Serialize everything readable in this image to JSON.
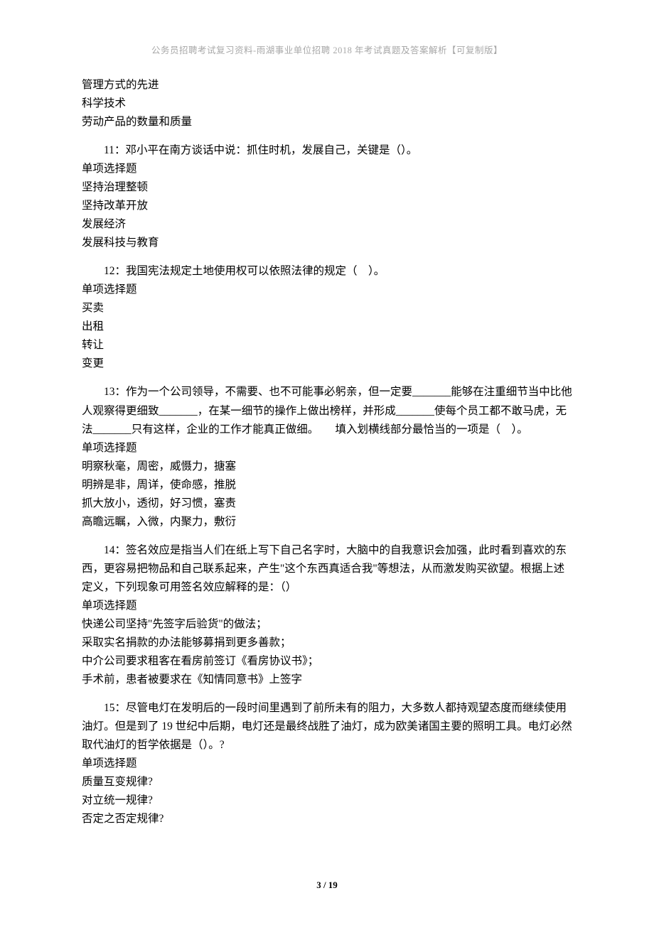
{
  "header": "公务员招聘考试复习资料-雨湖事业单位招聘 2018 年考试真题及答案解析【可复制版】",
  "footer": "3 / 19",
  "leading_options": [
    "管理方式的先进",
    "科学技术",
    "劳动产品的数量和质量"
  ],
  "questions": [
    {
      "number": "11",
      "text": "：邓小平在南方谈话中说：抓住时机，发展自己，关键是（）。",
      "qtype": "单项选择题",
      "options": [
        "坚持治理整顿",
        "坚持改革开放",
        "发展经济",
        "发展科技与教育"
      ]
    },
    {
      "number": "12",
      "text": "：我国宪法规定土地使用权可以依照法律的规定（　）。",
      "qtype": "单项选择题",
      "options": [
        "买卖",
        "出租",
        "转让",
        "变更"
      ]
    },
    {
      "number": "13",
      "text": "：作为一个公司领导，不需要、也不可能事必躬亲，但一定要_______能够在注重细节当中比他人观察得更细致_______，在某一细节的操作上做出榜样，并形成_______使每个员工都不敢马虎，无法_______只有这样，企业的工作才能真正做细。　　填入划横线部分最恰当的一项是（　）。",
      "qtype": "单项选择题",
      "options": [
        "明察秋毫，周密，威慑力，搪塞",
        "明辨是非，周详，使命感，推脱",
        "抓大放小，透彻，好习惯，塞责",
        "高瞻远瞩，入微，内聚力，敷衍"
      ]
    },
    {
      "number": "14",
      "text": "：签名效应是指当人们在纸上写下自己名字时，大脑中的自我意识会加强，此时看到喜欢的东西，更容易把物品和自己联系起来，产生\"这个东西真适合我\"等想法，从而激发购买欲望。根据上述定义，下列现象可用签名效应解释的是：（）",
      "qtype": "单项选择题",
      "options": [
        "快递公司坚持\"先签字后验货\"的做法；",
        "采取实名捐款的办法能够募捐到更多善款；",
        "中介公司要求租客在看房前签订《看房协议书》；",
        "手术前，患者被要求在《知情同意书》上签字"
      ]
    },
    {
      "number": "15",
      "text": "：尽管电灯在发明后的一段时间里遇到了前所未有的阻力，大多数人都持观望态度而继续使用油灯。但是到了 19 世纪中后期，电灯还是最终战胜了油灯，成为欧美诸国主要的照明工具。电灯必然取代油灯的哲学依据是（）。?",
      "qtype": "单项选择题",
      "options": [
        "质量互变规律?",
        "对立统一规律?",
        "否定之否定规律?"
      ]
    }
  ]
}
